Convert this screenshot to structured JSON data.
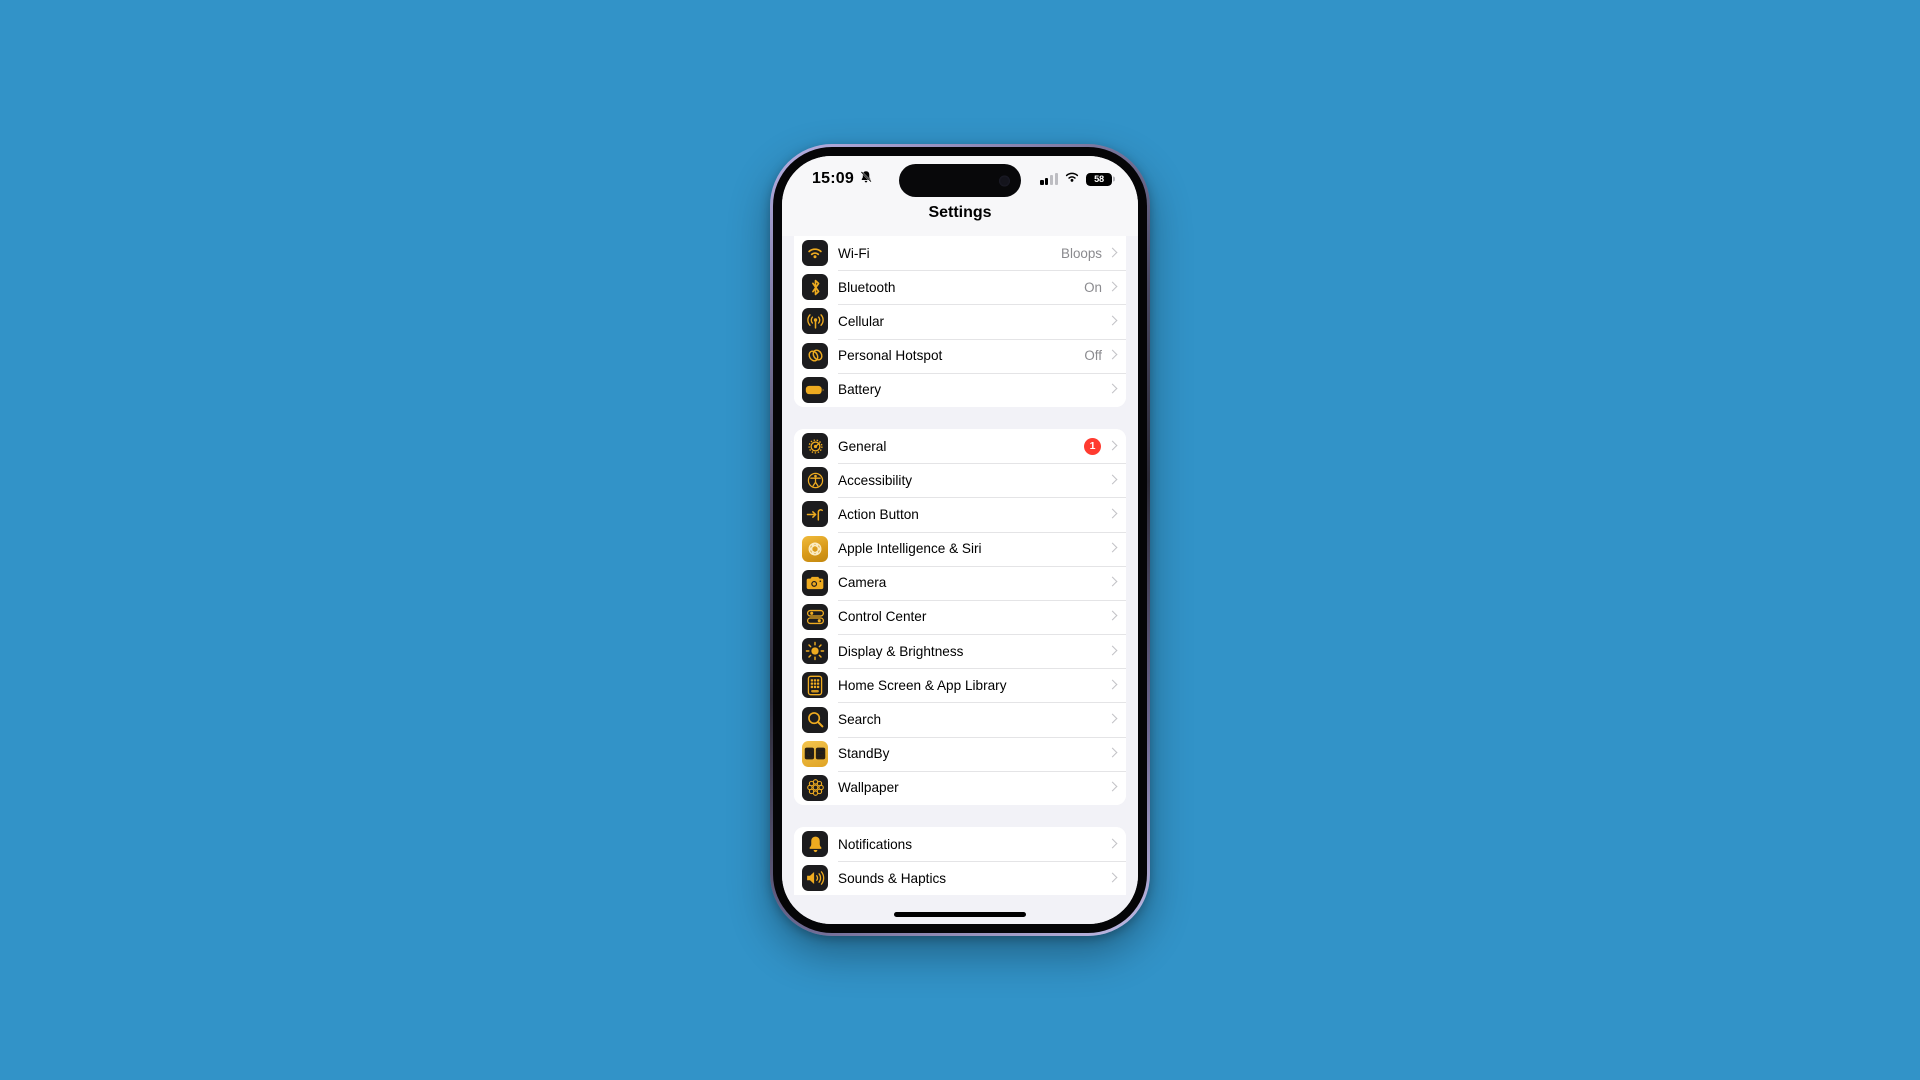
{
  "status_bar": {
    "time": "15:09",
    "mute_icon": "bell-slash-icon",
    "signal_icon": "cellular-signal-icon",
    "signal_bars_filled": 2,
    "signal_bars_total": 4,
    "wifi_icon": "wifi-icon",
    "battery_percent": "58",
    "battery_icon": "battery-icon"
  },
  "nav": {
    "title": "Settings"
  },
  "groups": [
    {
      "id": "connectivity",
      "rows": [
        {
          "icon": "wifi-icon",
          "label": "Wi-Fi",
          "value": "Bloops",
          "badge": ""
        },
        {
          "icon": "bluetooth-icon",
          "label": "Bluetooth",
          "value": "On",
          "badge": ""
        },
        {
          "icon": "cellular-icon",
          "label": "Cellular",
          "value": "",
          "badge": ""
        },
        {
          "icon": "personal-hotspot-icon",
          "label": "Personal Hotspot",
          "value": "Off",
          "badge": ""
        },
        {
          "icon": "battery-icon",
          "label": "Battery",
          "value": "",
          "badge": ""
        }
      ]
    },
    {
      "id": "system",
      "rows": [
        {
          "icon": "gear-icon",
          "label": "General",
          "value": "",
          "badge": "1"
        },
        {
          "icon": "accessibility-icon",
          "label": "Accessibility",
          "value": "",
          "badge": ""
        },
        {
          "icon": "action-button-icon",
          "label": "Action Button",
          "value": "",
          "badge": ""
        },
        {
          "icon": "apple-intelligence-icon",
          "label": "Apple Intelligence & Siri",
          "value": "",
          "badge": ""
        },
        {
          "icon": "camera-icon",
          "label": "Camera",
          "value": "",
          "badge": ""
        },
        {
          "icon": "control-center-icon",
          "label": "Control Center",
          "value": "",
          "badge": ""
        },
        {
          "icon": "display-brightness-icon",
          "label": "Display & Brightness",
          "value": "",
          "badge": ""
        },
        {
          "icon": "home-screen-icon",
          "label": "Home Screen & App Library",
          "value": "",
          "badge": ""
        },
        {
          "icon": "search-icon",
          "label": "Search",
          "value": "",
          "badge": ""
        },
        {
          "icon": "standby-icon",
          "label": "StandBy",
          "value": "",
          "badge": ""
        },
        {
          "icon": "wallpaper-icon",
          "label": "Wallpaper",
          "value": "",
          "badge": ""
        }
      ]
    },
    {
      "id": "alerts",
      "rows": [
        {
          "icon": "notifications-icon",
          "label": "Notifications",
          "value": "",
          "badge": ""
        },
        {
          "icon": "sounds-haptics-icon",
          "label": "Sounds & Haptics",
          "value": "",
          "badge": ""
        }
      ]
    }
  ],
  "colors": {
    "page_background": "#3293c8",
    "screen_background": "#f2f2f7",
    "card_background": "#ffffff",
    "icon_background": "#1c1c1e",
    "icon_glyph": "#eeab20",
    "badge_red": "#ff3b30",
    "secondary_text": "#8a8a8e"
  }
}
